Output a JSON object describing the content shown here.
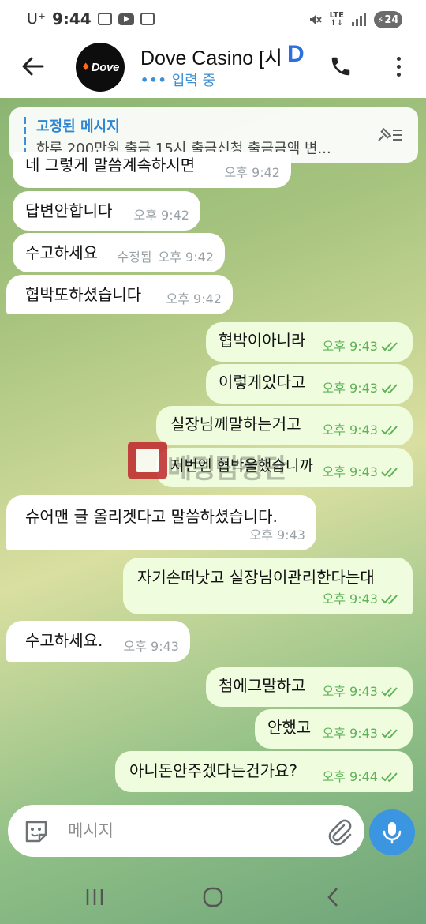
{
  "status_bar": {
    "carrier": "U⁺",
    "time": "9:44",
    "network": "LTE",
    "battery": "24",
    "icons": [
      "screenshot-icon",
      "youtube-icon",
      "gallery-icon",
      "mute-icon",
      "signal-icon",
      "battery-charging-icon"
    ]
  },
  "header": {
    "title": "Dove Casino [시",
    "title_badge": "D",
    "status": "입력 중",
    "avatar_text": "Dove"
  },
  "pinned": {
    "title": "고정된 메시지",
    "text": "하루 200만원 출금 15시 출금신청   출금금액 변..."
  },
  "messages": [
    {
      "direction": "in",
      "text": "네 그렇게 말씀계속하시면",
      "time": "오후 9:42",
      "edited": ""
    },
    {
      "direction": "in",
      "text": "답변안합니다",
      "time": "오후 9:42",
      "edited": ""
    },
    {
      "direction": "in",
      "text": "수고하세요",
      "time": "오후 9:42",
      "edited": "수정됨"
    },
    {
      "direction": "in",
      "text": "협박또하셨습니다",
      "time": "오후 9:42",
      "edited": ""
    },
    {
      "direction": "out",
      "text": "협박이아니라",
      "time": "오후 9:43",
      "read": true
    },
    {
      "direction": "out",
      "text": "이렇게있다고",
      "time": "오후 9:43",
      "read": true
    },
    {
      "direction": "out",
      "text": "실장님께말하는거고",
      "time": "오후 9:43",
      "read": true
    },
    {
      "direction": "out",
      "text": "저번엔 협박을했습니까",
      "time": "오후 9:43",
      "read": true
    },
    {
      "direction": "in",
      "text": "슈어맨 글 올리겟다고 말씀하셨습니다.",
      "time": "오후 9:43",
      "edited": ""
    },
    {
      "direction": "out",
      "text": "자기손떠낫고 실장님이관리한다는대",
      "time": "오후 9:43",
      "read": true
    },
    {
      "direction": "in",
      "text": "수고하세요.",
      "time": "오후 9:43",
      "edited": ""
    },
    {
      "direction": "out",
      "text": "첨에그말하고",
      "time": "오후 9:43",
      "read": true
    },
    {
      "direction": "out",
      "text": "안했고",
      "time": "오후 9:43",
      "read": true
    },
    {
      "direction": "out",
      "text": "아니돈안주겠다는건가요?",
      "time": "오후 9:44",
      "read": true
    }
  ],
  "watermark": {
    "text": "베팅탐정단"
  },
  "composer": {
    "placeholder": "메시지"
  },
  "colors": {
    "accent": "#3b95e0",
    "outgoing_bubble": "#effdde",
    "incoming_bubble": "#ffffff",
    "read_check": "#5fb25a"
  }
}
